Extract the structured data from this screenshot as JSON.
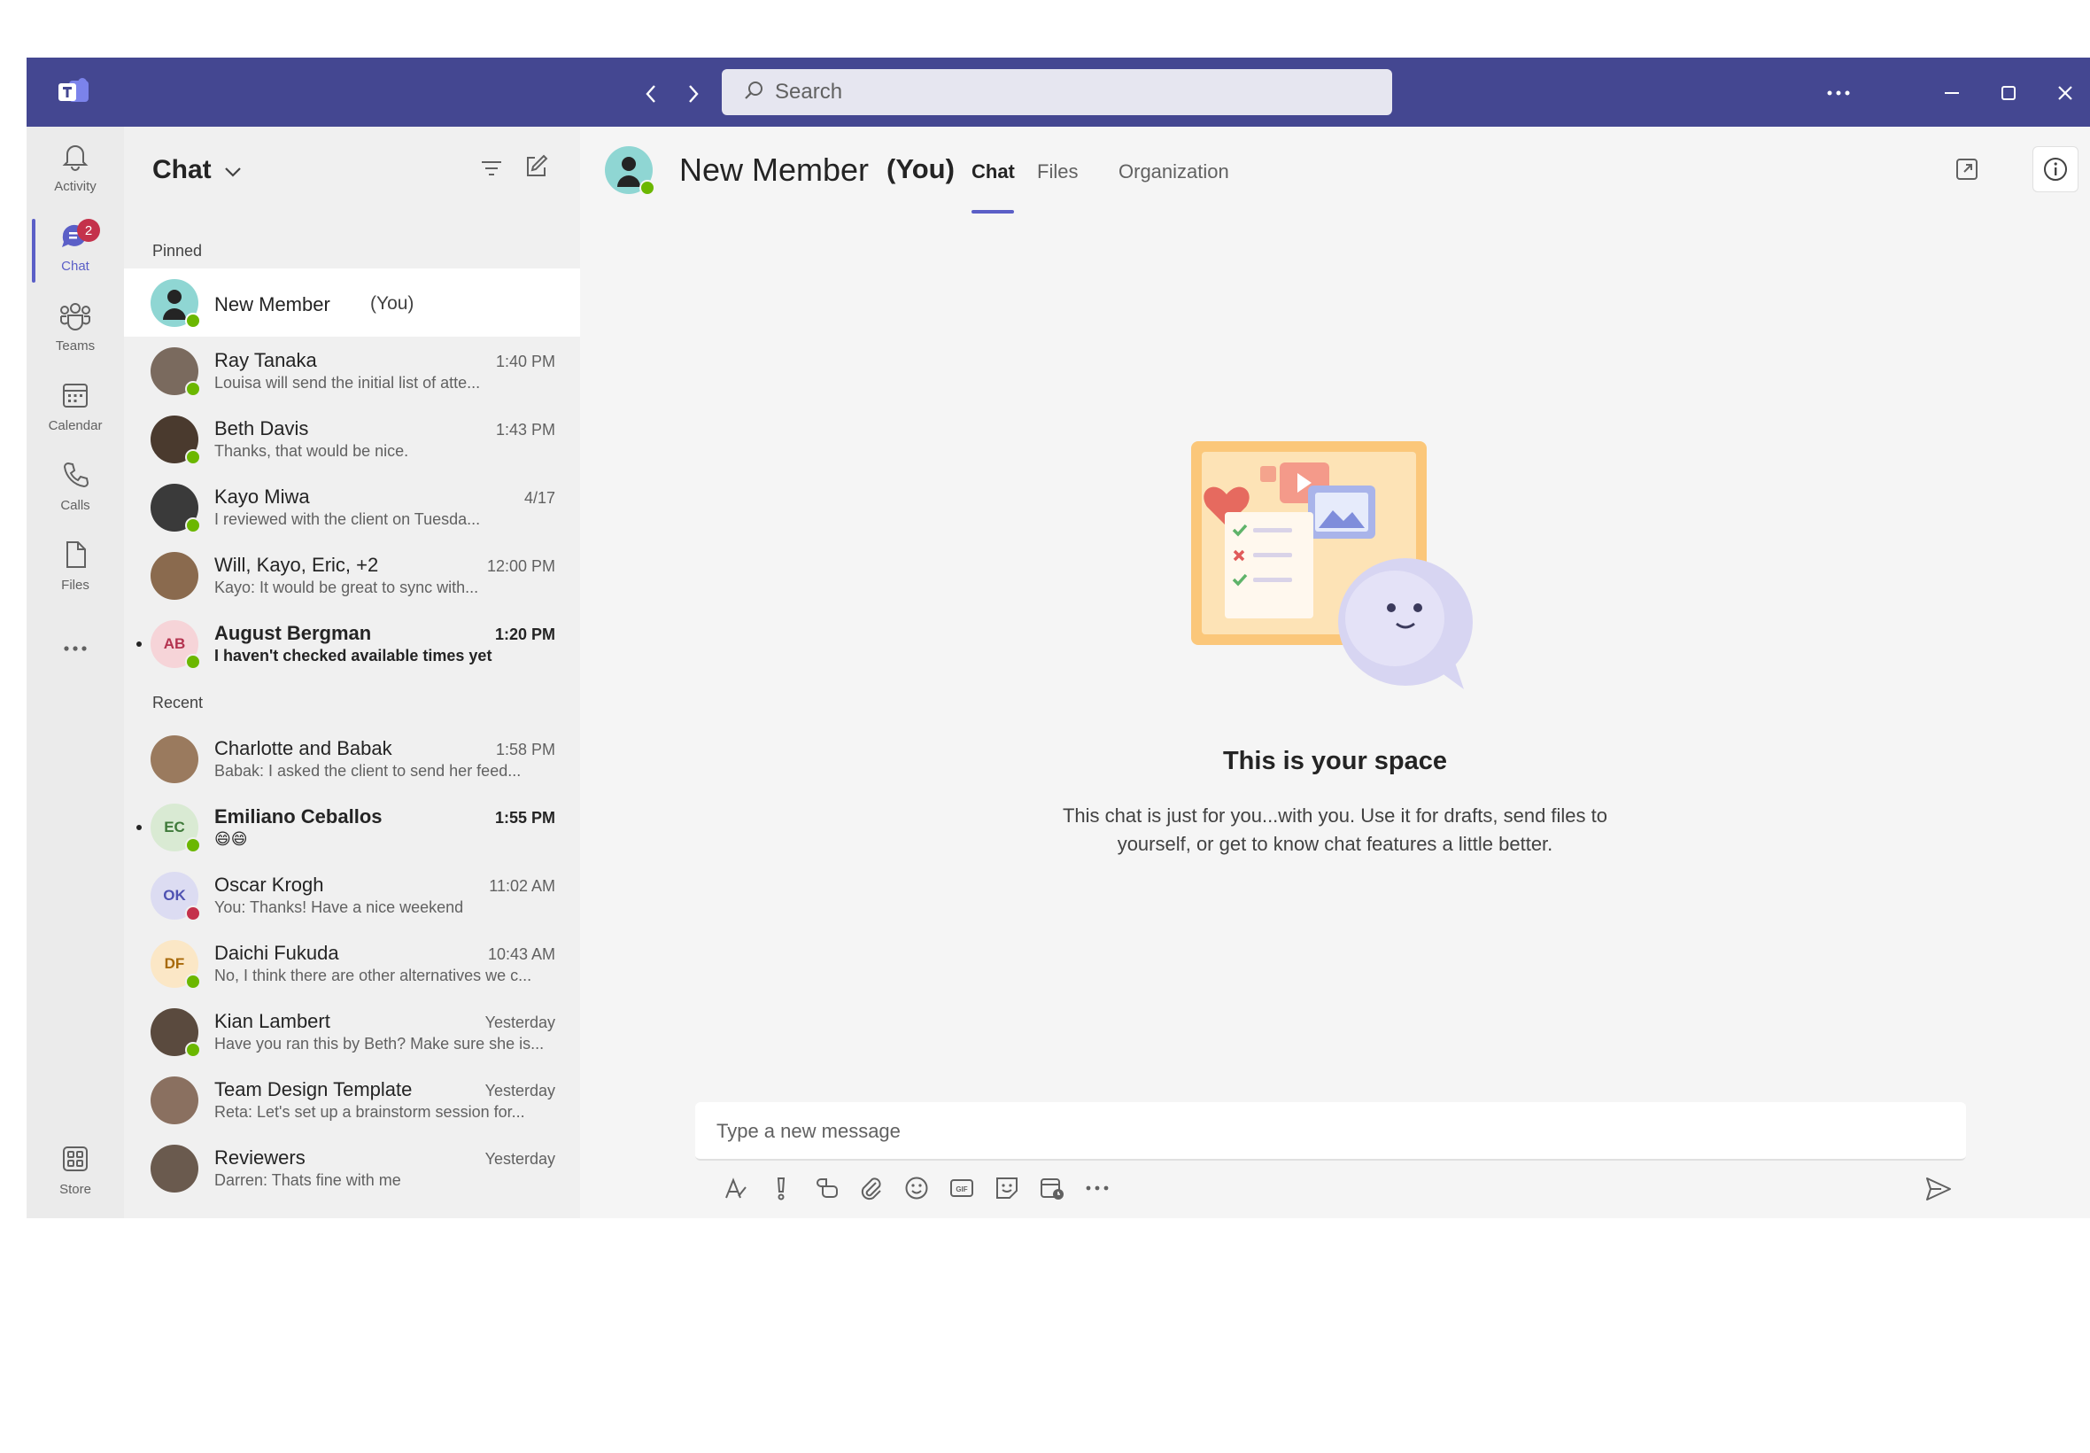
{
  "titlebar": {
    "search_placeholder": "Search",
    "more_label": "···"
  },
  "rail": {
    "items": [
      {
        "label": "Activity",
        "icon": "bell-icon"
      },
      {
        "label": "Chat",
        "icon": "chat-icon",
        "badge": "2",
        "active": true
      },
      {
        "label": "Teams",
        "icon": "teams-icon"
      },
      {
        "label": "Calendar",
        "icon": "calendar-icon"
      },
      {
        "label": "Calls",
        "icon": "phone-icon"
      },
      {
        "label": "Files",
        "icon": "file-icon"
      },
      {
        "label": "Store",
        "icon": "store-icon"
      }
    ],
    "more_label": "···"
  },
  "chatlist": {
    "title": "Chat",
    "pinned_label": "Pinned",
    "recent_label": "Recent",
    "pinned": [
      {
        "name": "New Member",
        "you": "(You)",
        "time": "",
        "preview": "",
        "initials": "",
        "color": "#8fd6d3",
        "presence": "available"
      },
      {
        "name": "Ray Tanaka",
        "time": "1:40 PM",
        "preview": "Louisa will send the initial list of atte...",
        "initials": "",
        "color": "#7a6a5e",
        "presence": "available"
      },
      {
        "name": "Beth Davis",
        "time": "1:43 PM",
        "preview": "Thanks, that would be nice.",
        "initials": "",
        "color": "#4a3a2e",
        "presence": "available"
      },
      {
        "name": "Kayo Miwa",
        "time": "4/17",
        "preview": "I reviewed with the client on Tuesda...",
        "initials": "",
        "color": "#3a3a3a",
        "presence": "available"
      },
      {
        "name": "Will, Kayo, Eric, +2",
        "time": "12:00 PM",
        "preview": "Kayo: It would be great to sync with...",
        "initials": "",
        "color": "#8a6a4e",
        "presence": ""
      },
      {
        "name": "August Bergman",
        "time": "1:20 PM",
        "preview": "I haven't checked available times yet",
        "initials": "AB",
        "color": "#f6d4d8",
        "text_color": "#b4334f",
        "presence": "available",
        "unread": true
      }
    ],
    "recent": [
      {
        "name": "Charlotte and Babak",
        "time": "1:58 PM",
        "preview": "Babak: I asked the client to send her feed...",
        "initials": "",
        "color": "#9a7a5e",
        "presence": ""
      },
      {
        "name": "Emiliano Ceballos",
        "time": "1:55 PM",
        "preview": "😄😄",
        "initials": "EC",
        "color": "#d9ead3",
        "text_color": "#3f7a3a",
        "presence": "available",
        "unread": true
      },
      {
        "name": "Oscar Krogh",
        "time": "11:02 AM",
        "preview": "You: Thanks! Have a nice weekend",
        "initials": "OK",
        "color": "#dcdcf2",
        "text_color": "#4f52b2",
        "presence": "dnd"
      },
      {
        "name": "Daichi Fukuda",
        "time": "10:43 AM",
        "preview": "No, I think there are other alternatives we c...",
        "initials": "DF",
        "color": "#fbe7c6",
        "text_color": "#a86a0a",
        "presence": "available"
      },
      {
        "name": "Kian Lambert",
        "time": "Yesterday",
        "preview": "Have you ran this by Beth? Make sure she is...",
        "initials": "",
        "color": "#5a4a3e",
        "presence": "available"
      },
      {
        "name": "Team Design Template",
        "time": "Yesterday",
        "preview": "Reta: Let's set up a brainstorm session for...",
        "initials": "",
        "color": "#8a7060",
        "presence": ""
      },
      {
        "name": "Reviewers",
        "time": "Yesterday",
        "preview": "Darren: Thats fine with me",
        "initials": "",
        "color": "#6a5a4e",
        "presence": ""
      }
    ]
  },
  "main": {
    "name": "New Member",
    "you": "(You)",
    "tabs": [
      "Chat",
      "Files",
      "Organization"
    ],
    "space_title": "This is your space",
    "space_body": "This chat is just for you...with you. Use it for drafts, send files to yourself, or get to know chat features a little better.",
    "composer_placeholder": "Type a new message",
    "tools": [
      "format-icon",
      "priority-icon",
      "loop-icon",
      "attach-icon",
      "emoji-icon",
      "gif-icon",
      "sticker-icon",
      "schedule-meeting-icon",
      "more-icon"
    ]
  }
}
